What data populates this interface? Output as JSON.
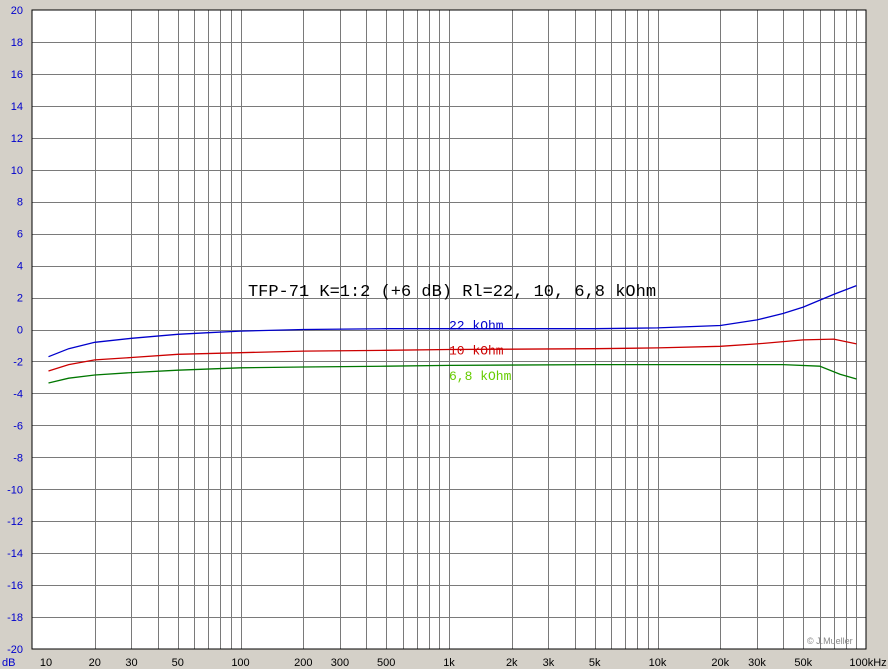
{
  "chart_data": {
    "type": "line",
    "title": "TFP-71 K=1:2 (+6 dB) Rl=22, 10, 6,8 kOhm",
    "ylabel": "dB",
    "xlabel": "",
    "x_unit_label": "100kHz",
    "x_scale": "log",
    "xlim": [
      10,
      100000
    ],
    "ylim": [
      -20,
      20
    ],
    "grid": true,
    "y_ticks": [
      20,
      18,
      16,
      14,
      12,
      10,
      8,
      6,
      4,
      2,
      0,
      -2,
      -4,
      -6,
      -8,
      -10,
      -12,
      -14,
      -16,
      -18,
      -20
    ],
    "x_ticks": [
      {
        "value": 10,
        "label": "10"
      },
      {
        "value": 20,
        "label": "20"
      },
      {
        "value": 30,
        "label": "30"
      },
      {
        "value": 50,
        "label": "50"
      },
      {
        "value": 100,
        "label": "100"
      },
      {
        "value": 200,
        "label": "200"
      },
      {
        "value": 300,
        "label": "300"
      },
      {
        "value": 500,
        "label": "500"
      },
      {
        "value": 1000,
        "label": "1k"
      },
      {
        "value": 2000,
        "label": "2k"
      },
      {
        "value": 3000,
        "label": "3k"
      },
      {
        "value": 5000,
        "label": "5k"
      },
      {
        "value": 10000,
        "label": "10k"
      },
      {
        "value": 20000,
        "label": "20k"
      },
      {
        "value": 30000,
        "label": "30k"
      },
      {
        "value": 50000,
        "label": "50k"
      }
    ],
    "series": [
      {
        "name": "22 kOhm",
        "color": "#0000cc",
        "label_at": [
          1000,
          0.25
        ],
        "points": [
          [
            12,
            -1.7
          ],
          [
            15,
            -1.2
          ],
          [
            20,
            -0.8
          ],
          [
            30,
            -0.55
          ],
          [
            50,
            -0.3
          ],
          [
            70,
            -0.2
          ],
          [
            100,
            -0.1
          ],
          [
            200,
            0.0
          ],
          [
            500,
            0.05
          ],
          [
            1000,
            0.05
          ],
          [
            5000,
            0.05
          ],
          [
            10000,
            0.1
          ],
          [
            20000,
            0.25
          ],
          [
            30000,
            0.6
          ],
          [
            40000,
            1.0
          ],
          [
            50000,
            1.4
          ],
          [
            70000,
            2.2
          ],
          [
            90000,
            2.75
          ]
        ]
      },
      {
        "name": "10 kOhm",
        "color": "#cc0000",
        "label_at": [
          1000,
          -1.3
        ],
        "points": [
          [
            12,
            -2.6
          ],
          [
            15,
            -2.2
          ],
          [
            20,
            -1.9
          ],
          [
            30,
            -1.75
          ],
          [
            50,
            -1.55
          ],
          [
            100,
            -1.45
          ],
          [
            200,
            -1.35
          ],
          [
            500,
            -1.3
          ],
          [
            1000,
            -1.25
          ],
          [
            5000,
            -1.2
          ],
          [
            10000,
            -1.15
          ],
          [
            20000,
            -1.05
          ],
          [
            30000,
            -0.9
          ],
          [
            50000,
            -0.65
          ],
          [
            70000,
            -0.6
          ],
          [
            90000,
            -0.9
          ]
        ]
      },
      {
        "name": "6,8 kOhm",
        "color": "#007700",
        "label_color": "#66cc00",
        "label_at": [
          1000,
          -2.9
        ],
        "points": [
          [
            12,
            -3.35
          ],
          [
            15,
            -3.05
          ],
          [
            20,
            -2.85
          ],
          [
            30,
            -2.7
          ],
          [
            50,
            -2.55
          ],
          [
            100,
            -2.4
          ],
          [
            200,
            -2.35
          ],
          [
            500,
            -2.3
          ],
          [
            1000,
            -2.25
          ],
          [
            5000,
            -2.2
          ],
          [
            10000,
            -2.2
          ],
          [
            20000,
            -2.2
          ],
          [
            40000,
            -2.2
          ],
          [
            60000,
            -2.3
          ],
          [
            75000,
            -2.8
          ],
          [
            90000,
            -3.1
          ]
        ]
      }
    ]
  },
  "credit": "© J.Mueller",
  "colors": {
    "plot_bg": "#ffffff",
    "frame_bg": "#d4d0c8",
    "grid": "#7a7a7a",
    "axis": "#000000"
  }
}
